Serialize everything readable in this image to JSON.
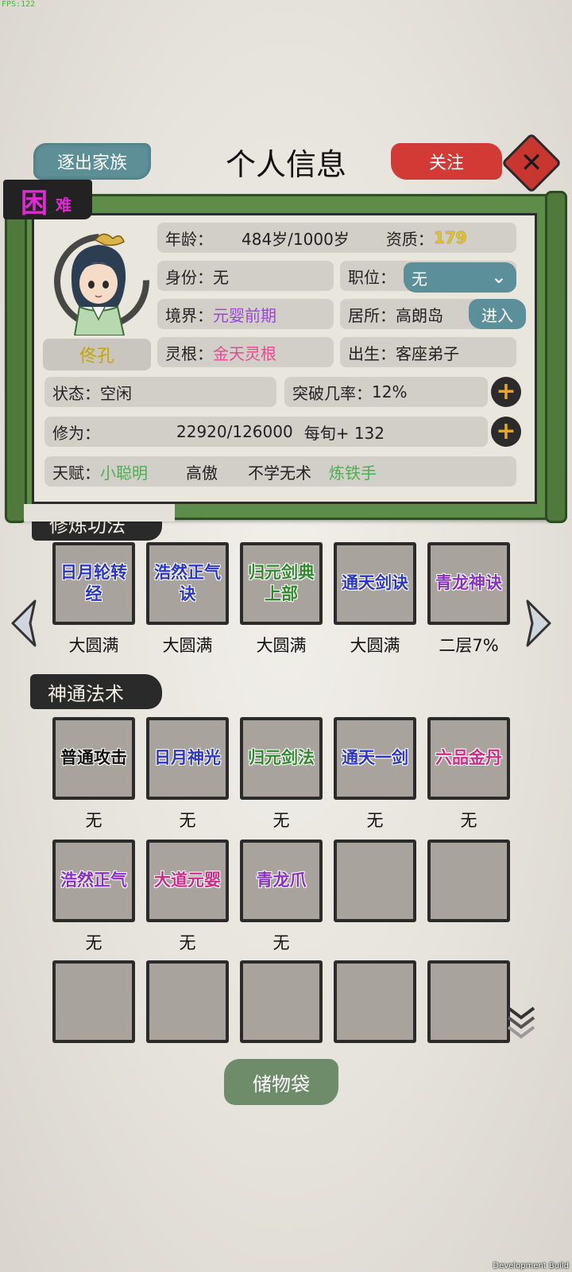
{
  "debug": {
    "fps": "FPS:122",
    "build": "Development Build"
  },
  "header": {
    "title": "个人信息",
    "expel_label": "逐出家族",
    "follow_label": "关注",
    "close_icon": "close-icon"
  },
  "profile": {
    "difficulty_big": "困",
    "difficulty_small": "难",
    "name": "佟孔",
    "age_label": "年龄：",
    "age_value": "484岁/1000岁",
    "aptitude_label": "资质：",
    "aptitude_value": "179",
    "identity_label": "身份：",
    "identity_value": "无",
    "position_label": "职位：",
    "position_value": "无",
    "realm_label": "境界：",
    "realm_value": "元婴前期",
    "residence_label": "居所：",
    "residence_value": "高朗岛",
    "enter_label": "进入",
    "root_label": "灵根：",
    "root_value": "金天灵根",
    "origin_label": "出生：",
    "origin_value": "客座弟子",
    "status_label": "状态：",
    "status_value": "空闲",
    "breakthrough_label": "突破几率：",
    "breakthrough_value": "12%",
    "cultivation_label": "修为：",
    "cultivation_value": "22920/126000",
    "per_period": "每旬+ 132",
    "talent_label": "天赋：",
    "talents": [
      "小聪明",
      "高傲",
      "不学无术",
      "炼铁手"
    ]
  },
  "cultivation_methods": {
    "title": "修炼功法",
    "items": [
      {
        "name": "日月轮转经",
        "line1": "日月轮转",
        "line2": "经",
        "level": "大圆满"
      },
      {
        "name": "浩然正气诀",
        "line1": "浩然正气",
        "line2": "诀",
        "level": "大圆满"
      },
      {
        "name": "归元剑典上部",
        "line1": "归元剑典",
        "line2": "上部",
        "level": "大圆满"
      },
      {
        "name": "通天剑诀",
        "line1": "通天剑诀",
        "line2": "",
        "level": "大圆满"
      },
      {
        "name": "青龙神诀",
        "line1": "青龙神诀",
        "line2": "",
        "level": "二层7%"
      }
    ]
  },
  "skills": {
    "title": "神通法术",
    "row1": [
      {
        "name": "普通攻击",
        "level": "无"
      },
      {
        "name": "日月神光",
        "level": "无"
      },
      {
        "name": "归元剑法",
        "level": "无"
      },
      {
        "name": "通天一剑",
        "level": "无"
      },
      {
        "name": "六品金丹",
        "level": "无"
      }
    ],
    "row2": [
      {
        "name": "浩然正气",
        "level": "无"
      },
      {
        "name": "大道元婴",
        "level": "无"
      },
      {
        "name": "青龙爪",
        "level": "无"
      }
    ]
  },
  "bag_label": "储物袋"
}
